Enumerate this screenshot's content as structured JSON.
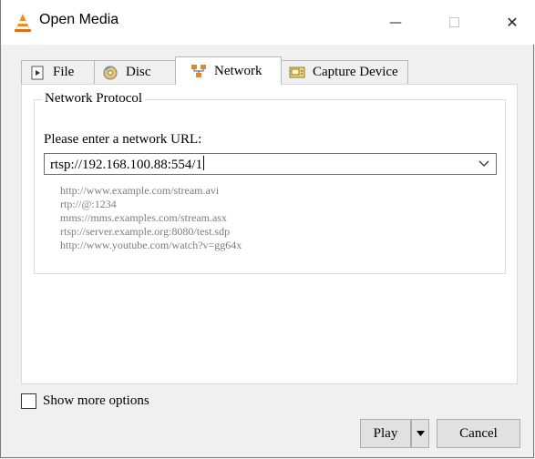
{
  "window": {
    "title": "Open Media",
    "minimize_glyph": "—",
    "close_glyph": "✕"
  },
  "tabs": [
    {
      "label": "File",
      "icon": "file-icon"
    },
    {
      "label": "Disc",
      "icon": "disc-icon"
    },
    {
      "label": "Network",
      "icon": "network-icon",
      "active": true
    },
    {
      "label": "Capture Device",
      "icon": "capture-device-icon"
    }
  ],
  "network": {
    "group_title": "Network Protocol",
    "url_prompt": "Please enter a network URL:",
    "url_value": "rtsp://192.168.100.88:554/1",
    "examples": [
      "http://www.example.com/stream.avi",
      "rtp://@:1234",
      "mms://mms.examples.com/stream.asx",
      "rtsp://server.example.org:8080/test.sdp",
      "http://www.youtube.com/watch?v=gg64x"
    ]
  },
  "footer": {
    "show_more_label": "Show more options",
    "show_more_checked": false,
    "play_label": "Play",
    "cancel_label": "Cancel"
  },
  "colors": {
    "vlc_orange": "#f08a24",
    "hint_text": "#7d7d7d"
  }
}
